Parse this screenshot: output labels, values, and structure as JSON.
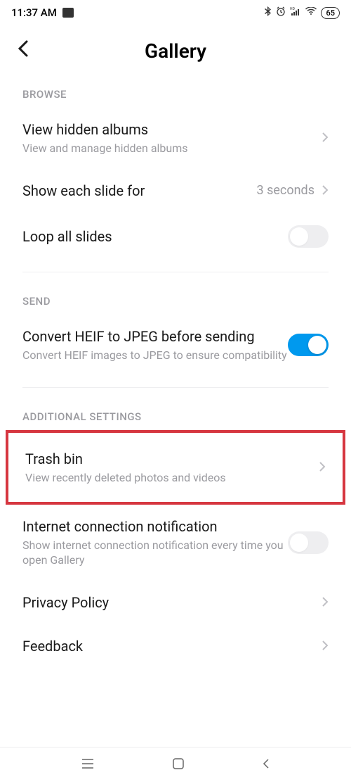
{
  "status_bar": {
    "time": "11:37 AM",
    "battery": "65"
  },
  "header": {
    "title": "Gallery"
  },
  "sections": {
    "browse": {
      "header": "BROWSE",
      "hidden_albums": {
        "title": "View hidden albums",
        "subtitle": "View and manage hidden albums"
      },
      "slide_duration": {
        "title": "Show each slide for",
        "value": "3 seconds"
      },
      "loop_slides": {
        "title": "Loop all slides"
      }
    },
    "send": {
      "header": "SEND",
      "convert_heif": {
        "title": "Convert HEIF to JPEG before sending",
        "subtitle": "Convert HEIF images to JPEG to ensure compatibility"
      }
    },
    "additional": {
      "header": "ADDITIONAL SETTINGS",
      "trash_bin": {
        "title": "Trash bin",
        "subtitle": "View recently deleted photos and videos"
      },
      "internet_notif": {
        "title": "Internet connection notification",
        "subtitle": "Show internet connection notification every time you open Gallery"
      },
      "privacy": {
        "title": "Privacy Policy"
      },
      "feedback": {
        "title": "Feedback"
      }
    }
  }
}
